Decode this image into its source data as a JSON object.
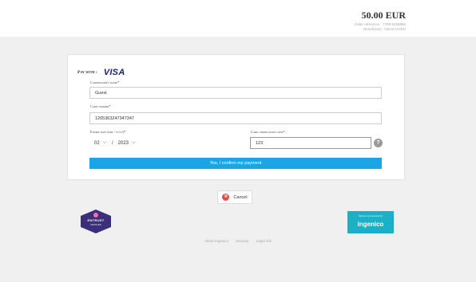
{
  "header": {
    "amount": "50.00 EUR",
    "order_reference": "Order reference : 7708-9228866",
    "beneficiary": "Beneficiary : Interxt GmbH"
  },
  "payment": {
    "pay_with_label": "Pay with :",
    "brand": "VISA",
    "cardholder_label": "Cardholder's name*",
    "cardholder_value": "Guest",
    "card_number_label": "Card number*",
    "card_number_value": "1265363247347347",
    "expiry_label": "Expiry date (mm / yyyy)*",
    "expiry_month": "02",
    "expiry_separator": "/",
    "expiry_year": "2023",
    "cvc_label": "Card verification code* :",
    "cvc_value": "123",
    "help_glyph": "?",
    "confirm_label": "Yes, I confirm my payment"
  },
  "cancel": {
    "label": "Cancel",
    "icon_glyph": "✕"
  },
  "badges": {
    "entrust_name": "ENTRUST",
    "entrust_sub": "VERIFIED",
    "ingenico_sub": "Payment processed by",
    "ingenico_name": "ingenico"
  },
  "footer": {
    "links": [
      "About Ingenico",
      "Security",
      "Legal info"
    ]
  },
  "colors": {
    "accent": "#1ca5e6",
    "visa": "#1a1f71",
    "cancel_icon": "#e54b4b",
    "entrust": "#3b2f7a",
    "ingenico": "#1bb0c6"
  }
}
